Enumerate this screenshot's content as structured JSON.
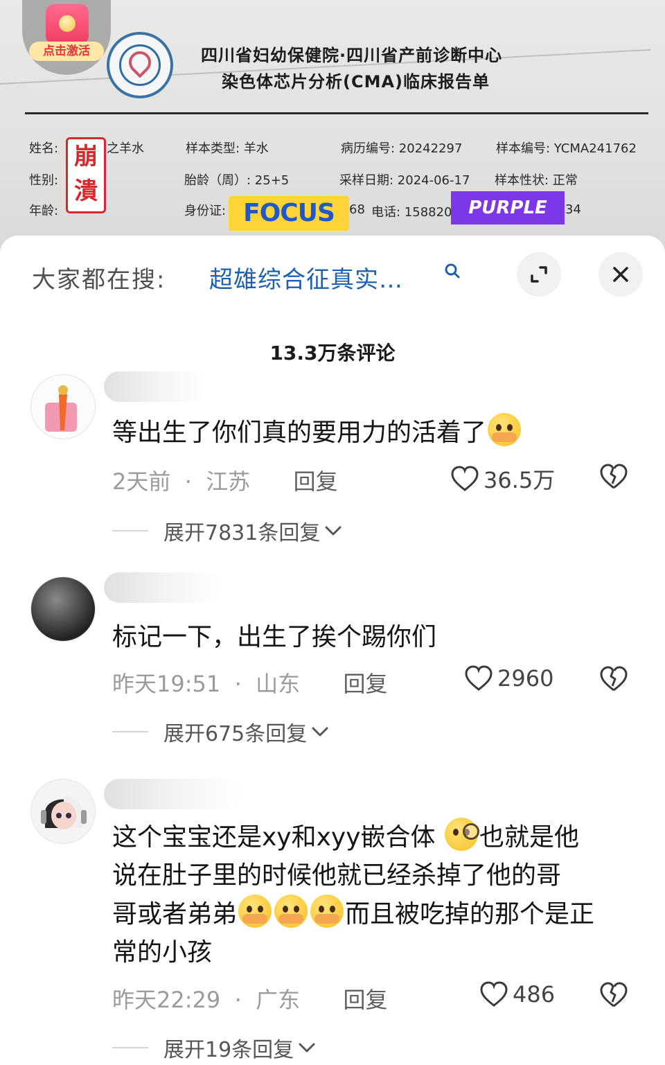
{
  "document": {
    "activate_badge": "点击激活",
    "title_line1": "四川省妇幼保健院·四川省产前诊断中心",
    "title_line2": "染色体芯片分析(CMA)临床报告单",
    "fields": {
      "name_label": "姓名:",
      "name_value": "之羊水",
      "gender_label": "性别:",
      "age_label": "年龄:",
      "sample_type": "样本类型:  羊水",
      "gestational_age": "胎龄（周）:  25+5",
      "id_label": "身份证:",
      "id_partial": "68",
      "phone": "电话:  158820",
      "phone_tail": "34",
      "record_no": "病历编号:  20242297",
      "sampling_date": "采样日期:  2024-06-17",
      "sample_no": "样本编号:  YCMA241762",
      "sample_status": "样本性状:  正常"
    },
    "sticker_text": "崩潰",
    "focus_sticker": "FOCUS",
    "purple_sticker": "PURPLE"
  },
  "search": {
    "prefix": "大家都在搜:",
    "query": "超雄综合征真实…"
  },
  "comment_count": "13.3万条评论",
  "comments": [
    {
      "text": "等出生了你们真的要用力的活着了",
      "time": "2天前",
      "location": "江苏",
      "reply_label": "回复",
      "likes": "36.5万",
      "expand": "展开7831条回复"
    },
    {
      "text": "标记一下，出生了挨个踢你们",
      "time": "昨天19:51",
      "location": "山东",
      "reply_label": "回复",
      "likes": "2960",
      "expand": "展开675条回复"
    },
    {
      "text_line1_a": "这个宝宝还是xy和xyy嵌合体",
      "text_line1_b": "也就是他",
      "text_line2": "说在肚子里的时候他就已经杀掉了他的哥",
      "text_line3_a": "哥或者弟弟",
      "text_line3_b": "而且被吃掉的那个是正",
      "text_line4": "常的小孩",
      "time": "昨天22:29",
      "location": "广东",
      "reply_label": "回复",
      "likes": "486",
      "expand": "展开19条回复"
    }
  ],
  "colors": {
    "search_query": "#1e5fae",
    "focus_bg": "#ffd43a",
    "purple_bg": "#7c37e6",
    "sticker_red": "#d4282a"
  }
}
